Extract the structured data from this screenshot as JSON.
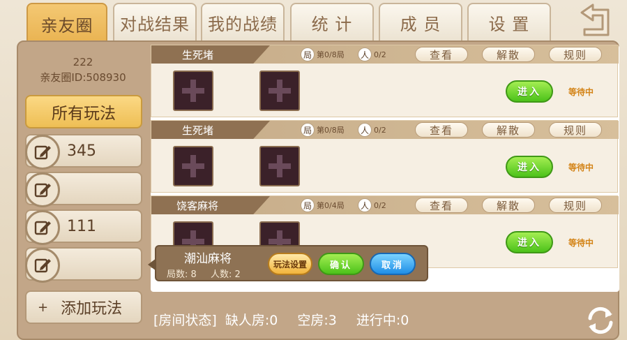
{
  "tabs": [
    {
      "label": "亲友圈",
      "active": true
    },
    {
      "label": "对战结果",
      "active": false
    },
    {
      "label": "我的战绩",
      "active": false
    },
    {
      "label": "统  计",
      "active": false
    },
    {
      "label": "成  员",
      "active": false
    },
    {
      "label": "设  置",
      "active": false
    }
  ],
  "back_icon": "back-arrow-icon",
  "sidebar": {
    "club_name": "222",
    "club_id": "亲友圈ID:508930",
    "all_modes": "所有玩法",
    "modes": [
      {
        "label": "345"
      },
      {
        "label": ""
      },
      {
        "label": "111"
      },
      {
        "label": ""
      }
    ],
    "add_mode_plus": "+",
    "add_mode": "添加玩法"
  },
  "rooms": [
    {
      "name": "生死堵",
      "round_icon": "局",
      "round": "第0/8局",
      "player_icon": "人",
      "players": "0/2",
      "view": "查看",
      "dissolve": "解散",
      "rules": "规则",
      "enter": "进入",
      "status": "等待中"
    },
    {
      "name": "生死堵",
      "round_icon": "局",
      "round": "第0/8局",
      "player_icon": "人",
      "players": "0/2",
      "view": "查看",
      "dissolve": "解散",
      "rules": "规则",
      "enter": "进入",
      "status": "等待中"
    },
    {
      "name": "饶客麻将",
      "round_icon": "局",
      "round": "第0/4局",
      "player_icon": "人",
      "players": "0/2",
      "view": "查看",
      "dissolve": "解散",
      "rules": "规则",
      "enter": "进入",
      "status": "等待中"
    }
  ],
  "status_bar": {
    "label": "[房间状态]",
    "missing": "缺人房:0",
    "empty": "空房:3",
    "in_progress": "进行中:0"
  },
  "popup": {
    "title": "潮汕麻将",
    "rounds": "局数: 8",
    "players": "人数: 2",
    "settings_btn": "玩法设置",
    "confirm_btn": "确认",
    "cancel_btn": "取消"
  },
  "colors": {
    "gold": "#eebf55",
    "green": "#4cc21a",
    "blue": "#1f8ee6",
    "frame": "#c2a688"
  }
}
